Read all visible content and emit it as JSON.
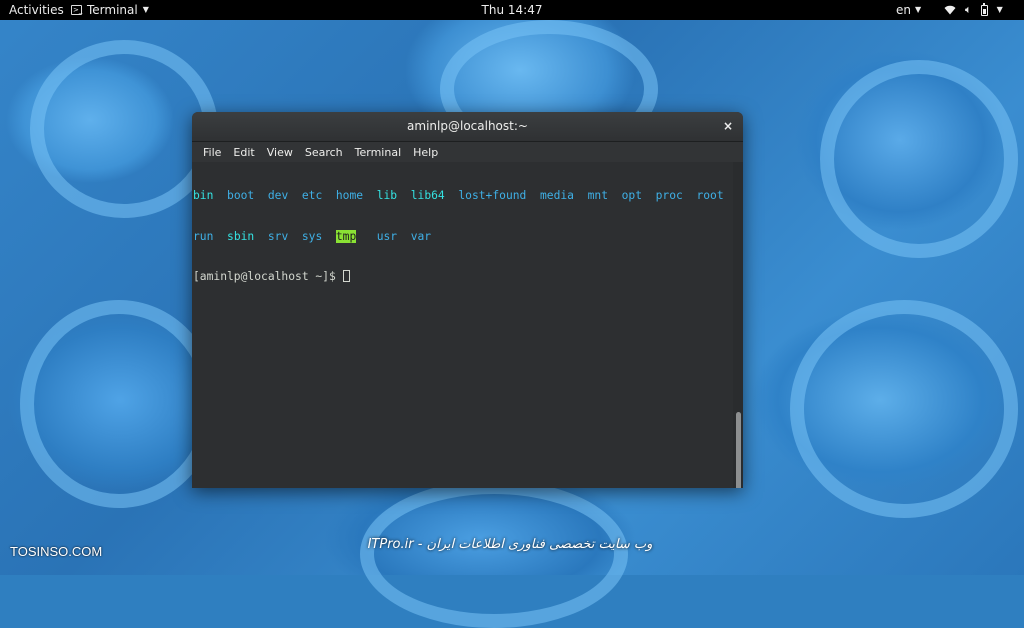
{
  "topbar": {
    "activities": "Activities",
    "app_name": "Terminal",
    "clock": "Thu 14:47",
    "language": "en"
  },
  "window": {
    "title": "aminlp@localhost:~",
    "close": "×"
  },
  "menu": {
    "file": "File",
    "edit": "Edit",
    "view": "View",
    "search": "Search",
    "terminal": "Terminal",
    "help": "Help"
  },
  "terminal": {
    "line1": [
      {
        "name": "bin",
        "kind": "link"
      },
      {
        "name": "boot",
        "kind": "dir"
      },
      {
        "name": "dev",
        "kind": "dir"
      },
      {
        "name": "etc",
        "kind": "dir"
      },
      {
        "name": "home",
        "kind": "dir"
      },
      {
        "name": "lib",
        "kind": "link"
      },
      {
        "name": "lib64",
        "kind": "link"
      },
      {
        "name": "lost+found",
        "kind": "dir"
      },
      {
        "name": "media",
        "kind": "dir"
      },
      {
        "name": "mnt",
        "kind": "dir"
      },
      {
        "name": "opt",
        "kind": "dir"
      },
      {
        "name": "proc",
        "kind": "dir"
      },
      {
        "name": "root",
        "kind": "dir"
      }
    ],
    "line2": [
      {
        "name": "run",
        "kind": "dir"
      },
      {
        "name": "sbin",
        "kind": "link"
      },
      {
        "name": "srv",
        "kind": "dir"
      },
      {
        "name": "sys",
        "kind": "dir"
      },
      {
        "name": "tmp",
        "kind": "dir-hl"
      },
      {
        "name": "usr",
        "kind": "dir"
      },
      {
        "name": "var",
        "kind": "dir"
      }
    ],
    "prompt": "[aminlp@localhost ~]$ "
  },
  "watermark": {
    "left": "TOSINSO.COM",
    "center": "ITPro.ir - وب سایت تخصصی فناوری اطلاعات ایران"
  },
  "colors": {
    "dir": "#3fb0e6",
    "link": "#34e2e2",
    "highlight_bg": "#8ae234"
  }
}
